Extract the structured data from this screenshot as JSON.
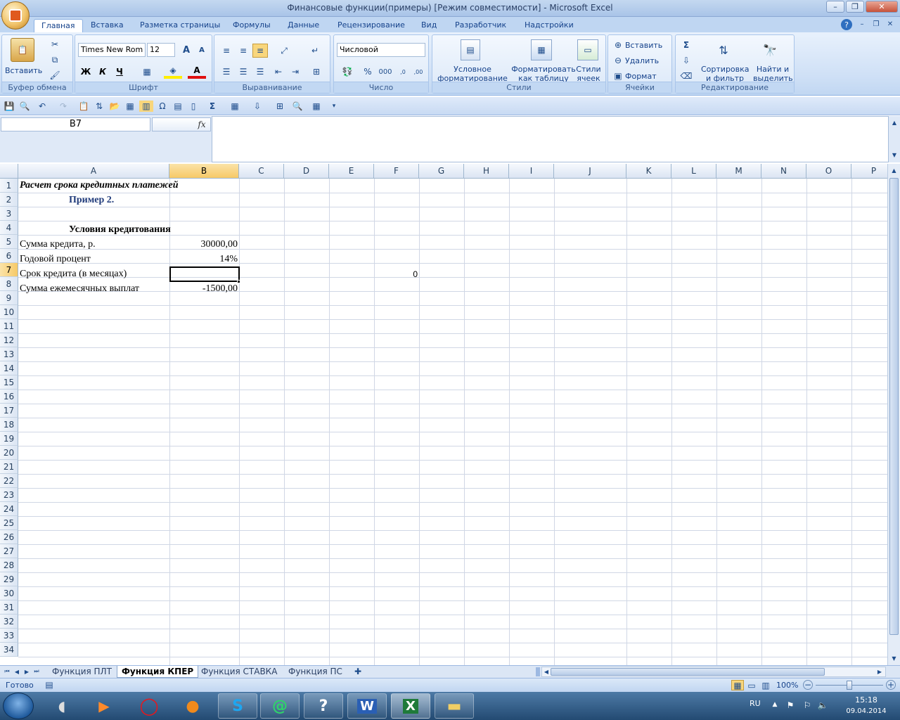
{
  "window": {
    "title": "Финансовые функции(примеры)  [Режим совместимости] - Microsoft Excel",
    "controls": [
      "–",
      "❐",
      "✕"
    ]
  },
  "ribbon_tabs": [
    "Главная",
    "Вставка",
    "Разметка страницы",
    "Формулы",
    "Данные",
    "Рецензирование",
    "Вид",
    "Разработчик",
    "Надстройки"
  ],
  "active_tab": "Главная",
  "ribbon": {
    "clipboard": {
      "paste": "Вставить",
      "caption": "Буфер обмена"
    },
    "font": {
      "name": "Times New Rom",
      "size": "12",
      "bold": "Ж",
      "italic": "К",
      "underline": "Ч",
      "caption": "Шрифт"
    },
    "alignment": {
      "caption": "Выравнивание"
    },
    "number": {
      "format": "Числовой",
      "percent": "%",
      "thousands": "000",
      "caption": "Число"
    },
    "styles": {
      "conditional": "Условное\nформатирование",
      "as_table": "Форматировать\nкак таблицу",
      "cell_styles": "Стили\nячеек",
      "caption": "Стили"
    },
    "cells": {
      "insert": "Вставить",
      "delete": "Удалить",
      "format": "Формат",
      "caption": "Ячейки"
    },
    "editing": {
      "sort": "Сортировка\nи фильтр",
      "find": "Найти и\nвыделить",
      "caption": "Редактирование"
    }
  },
  "formula_bar": {
    "name_box": "B7",
    "fx": "fx",
    "formula": ""
  },
  "columns": [
    "A",
    "B",
    "C",
    "D",
    "E",
    "F",
    "G",
    "H",
    "I",
    "J",
    "K",
    "L",
    "M",
    "N",
    "O",
    "P"
  ],
  "selected_column": "B",
  "rows": [
    "1",
    "2",
    "3",
    "4",
    "5",
    "6",
    "7",
    "8",
    "9",
    "10",
    "11",
    "12",
    "13",
    "14",
    "15",
    "16",
    "17",
    "18",
    "19",
    "20",
    "21",
    "22",
    "23",
    "24",
    "25",
    "26",
    "27",
    "28",
    "29",
    "30",
    "31",
    "32",
    "33",
    "34"
  ],
  "selected_row": "7",
  "cells": {
    "A1": "Расчет срока кредитных платежей",
    "A2": "Пример 2.",
    "A4": "Условия кредитования",
    "A5": "Сумма кредита, р.",
    "B5": "30000,00",
    "A6": "Годовой процент",
    "B6": "14%",
    "A7": "Срок кредита (в месяцах)",
    "F7": "0",
    "A8": "Сумма ежемесячных выплат",
    "B8": "-1500,00"
  },
  "sheets": [
    "Функция ПЛТ",
    "Функция КПЕР",
    "Функция СТАВКА",
    "Функция ПС"
  ],
  "active_sheet": "Функция КПЕР",
  "status": {
    "ready": "Готово",
    "zoom": "100%"
  },
  "taskbar": {
    "lang": "RU",
    "time": "15:18",
    "date": "09.04.2014"
  },
  "colors": {
    "accent": "#15428b",
    "ribbon_bg": "#cfe0f6",
    "selection_header": "#f6c967",
    "taskbar": "#234a72"
  }
}
